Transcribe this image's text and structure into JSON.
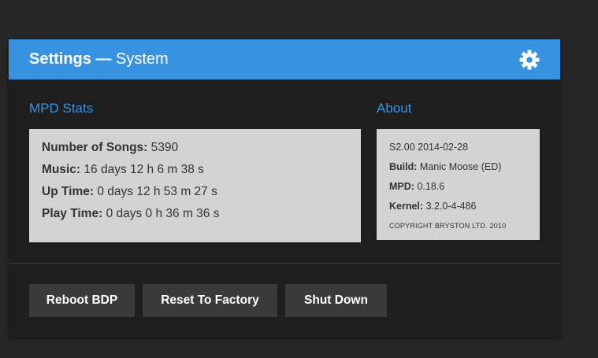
{
  "header": {
    "title_strong": "Settings —",
    "title_light": "System",
    "settings_icon": "gear-icon"
  },
  "mpd_stats": {
    "heading": "MPD Stats",
    "items": [
      {
        "label": "Number of Songs:",
        "value": "5390"
      },
      {
        "label": "Music:",
        "value": "16 days 12 h 6 m 38 s"
      },
      {
        "label": "Up Time:",
        "value": "0 days 12 h 53 m 27 s"
      },
      {
        "label": "Play Time:",
        "value": "0 days 0 h 36 m 36 s"
      }
    ]
  },
  "about": {
    "heading": "About",
    "version": "S2.00 2014-02-28",
    "build_label": "Build:",
    "build_value": "Manic Moose (ED)",
    "mpd_label": "MPD:",
    "mpd_value": "0.18.6",
    "kernel_label": "Kernel:",
    "kernel_value": "3.2.0-4-486",
    "copyright": "COPYRIGHT BRYSTON LTD. 2010"
  },
  "actions": {
    "reboot": "Reboot BDP",
    "reset": "Reset To Factory",
    "shutdown": "Shut Down"
  },
  "colors": {
    "accent": "#3793e0",
    "panel_bg": "#1e1e1e",
    "page_bg": "#262626",
    "box_bg": "#d3d3d3",
    "button_bg": "#3a3a3a"
  }
}
